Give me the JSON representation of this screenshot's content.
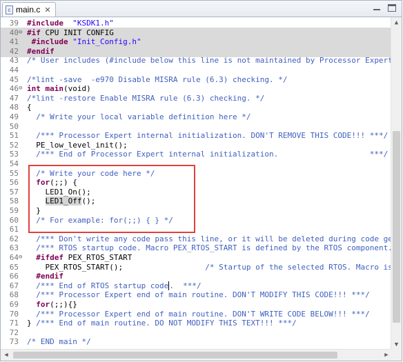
{
  "tab": {
    "title": "main.c",
    "icon": "c-file-icon",
    "close_glyph": "✕"
  },
  "window_buttons": {
    "minimize": "minimize-icon",
    "maximize": "maximize-icon"
  },
  "code_lines": [
    {
      "n": "39",
      "fold": "",
      "hl": false,
      "parts": [
        [
          "kw",
          "#include"
        ],
        [
          "",
          "  "
        ],
        [
          "str",
          "\"KSDK1.h\""
        ]
      ]
    },
    {
      "n": "40",
      "fold": "⊖",
      "hl": true,
      "parts": [
        [
          "kw",
          "#if"
        ],
        [
          "",
          " CPU_INIT_CONFIG"
        ]
      ]
    },
    {
      "n": "41",
      "fold": "",
      "hl": true,
      "parts": [
        [
          "",
          " "
        ],
        [
          "kw",
          "#include"
        ],
        [
          "",
          " "
        ],
        [
          "str",
          "\"Init_Config.h\""
        ]
      ]
    },
    {
      "n": "42",
      "fold": "",
      "hl": true,
      "parts": [
        [
          "kw",
          "#endif"
        ]
      ]
    },
    {
      "n": "43",
      "fold": "",
      "hl": false,
      "parts": [
        [
          "cm",
          "/* User includes (#include below this line is not maintained by Processor Expert"
        ]
      ]
    },
    {
      "n": "44",
      "fold": "",
      "hl": false,
      "parts": []
    },
    {
      "n": "45",
      "fold": "",
      "hl": false,
      "parts": [
        [
          "cm",
          "/*lint -save  -e970 Disable MISRA rule (6.3) checking. */"
        ]
      ]
    },
    {
      "n": "46",
      "fold": "⊖",
      "hl": false,
      "parts": [
        [
          "kw",
          "int"
        ],
        [
          "",
          " "
        ],
        [
          "kw",
          "main"
        ],
        [
          "",
          "(void)"
        ]
      ]
    },
    {
      "n": "47",
      "fold": "",
      "hl": false,
      "parts": [
        [
          "cm",
          "/*lint -restore Enable MISRA rule (6.3) checking. */"
        ]
      ]
    },
    {
      "n": "48",
      "fold": "",
      "hl": false,
      "parts": [
        [
          "",
          "{"
        ]
      ]
    },
    {
      "n": "49",
      "fold": "",
      "hl": false,
      "parts": [
        [
          "",
          "  "
        ],
        [
          "cm",
          "/* Write your local variable definition here */"
        ]
      ]
    },
    {
      "n": "50",
      "fold": "",
      "hl": false,
      "parts": []
    },
    {
      "n": "51",
      "fold": "",
      "hl": false,
      "parts": [
        [
          "",
          "  "
        ],
        [
          "cm",
          "/*** Processor Expert internal initialization. DON'T REMOVE THIS CODE!!! ***/"
        ]
      ]
    },
    {
      "n": "52",
      "fold": "",
      "hl": false,
      "parts": [
        [
          "",
          "  PE_low_level_init();"
        ]
      ]
    },
    {
      "n": "53",
      "fold": "",
      "hl": false,
      "parts": [
        [
          "",
          "  "
        ],
        [
          "cm",
          "/*** End of Processor Expert internal initialization.                    ***/"
        ]
      ]
    },
    {
      "n": "54",
      "fold": "",
      "hl": false,
      "parts": []
    },
    {
      "n": "55",
      "fold": "",
      "hl": false,
      "parts": [
        [
          "",
          "  "
        ],
        [
          "cm",
          "/* Write your code here */"
        ]
      ]
    },
    {
      "n": "56",
      "fold": "",
      "hl": false,
      "parts": [
        [
          "",
          "  "
        ],
        [
          "kw",
          "for"
        ],
        [
          "",
          "(;;) {"
        ]
      ]
    },
    {
      "n": "57",
      "fold": "",
      "hl": false,
      "parts": [
        [
          "",
          "    LED1_On();"
        ]
      ]
    },
    {
      "n": "58",
      "fold": "",
      "hl": false,
      "parts": [
        [
          "",
          "    "
        ],
        [
          "occ",
          "LED1_Off"
        ],
        [
          "",
          "();"
        ]
      ]
    },
    {
      "n": "59",
      "fold": "",
      "hl": false,
      "parts": [
        [
          "",
          "  }"
        ]
      ]
    },
    {
      "n": "60",
      "fold": "",
      "hl": false,
      "parts": [
        [
          "",
          "  "
        ],
        [
          "cm",
          "/* For example: for(;;) { } */"
        ]
      ]
    },
    {
      "n": "61",
      "fold": "",
      "hl": false,
      "parts": []
    },
    {
      "n": "62",
      "fold": "",
      "hl": false,
      "parts": [
        [
          "",
          "  "
        ],
        [
          "cm",
          "/*** Don't write any code pass this line, or it will be deleted during code ge"
        ]
      ]
    },
    {
      "n": "63",
      "fold": "",
      "hl": false,
      "parts": [
        [
          "",
          "  "
        ],
        [
          "cm",
          "/*** RTOS startup code. Macro PEX_RTOS_START is defined by the RTOS component."
        ]
      ]
    },
    {
      "n": "64",
      "fold": "⊖",
      "hl": false,
      "parts": [
        [
          "",
          "  "
        ],
        [
          "kw",
          "#ifdef"
        ],
        [
          "",
          " PEX_RTOS_START"
        ]
      ]
    },
    {
      "n": "65",
      "fold": "",
      "hl": false,
      "parts": [
        [
          "",
          "    PEX_RTOS_START();                  "
        ],
        [
          "cm",
          "/* Startup of the selected RTOS. Macro is"
        ]
      ]
    },
    {
      "n": "66",
      "fold": "",
      "hl": false,
      "parts": [
        [
          "",
          "  "
        ],
        [
          "kw",
          "#endif"
        ]
      ]
    },
    {
      "n": "67",
      "fold": "",
      "hl": false,
      "parts": [
        [
          "",
          "  "
        ],
        [
          "cm",
          "/*** End of RTOS startup code"
        ],
        [
          "caret",
          ""
        ],
        [
          "cm",
          ".  ***/"
        ]
      ]
    },
    {
      "n": "68",
      "fold": "",
      "hl": false,
      "parts": [
        [
          "",
          "  "
        ],
        [
          "cm",
          "/*** Processor Expert end of main routine. DON'T MODIFY THIS CODE!!! ***/"
        ]
      ]
    },
    {
      "n": "69",
      "fold": "",
      "hl": false,
      "parts": [
        [
          "",
          "  "
        ],
        [
          "kw",
          "for"
        ],
        [
          "",
          "(;;){}"
        ]
      ]
    },
    {
      "n": "70",
      "fold": "",
      "hl": false,
      "parts": [
        [
          "",
          "  "
        ],
        [
          "cm",
          "/*** Processor Expert end of main routine. DON'T WRITE CODE BELOW!!! ***/"
        ]
      ]
    },
    {
      "n": "71",
      "fold": "",
      "hl": false,
      "parts": [
        [
          "",
          "} "
        ],
        [
          "cm",
          "/*** End of main routine. DO NOT MODIFY THIS TEXT!!! ***/"
        ]
      ]
    },
    {
      "n": "72",
      "fold": "",
      "hl": false,
      "parts": []
    },
    {
      "n": "73",
      "fold": "",
      "hl": false,
      "parts": [
        [
          "cm",
          "/* END main */"
        ]
      ]
    }
  ],
  "scroll_glyphs": {
    "up": "▲",
    "down": "▼",
    "left": "◀",
    "right": "▶"
  }
}
